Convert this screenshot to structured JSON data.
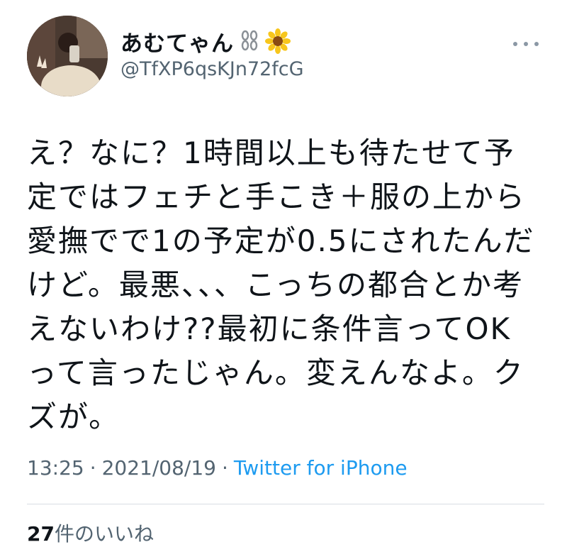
{
  "user": {
    "display_name": "あむてゃん",
    "name_icons": [
      "chain-icon",
      "sunflower-icon"
    ],
    "handle": "@TfXP6qsKJn72fcG"
  },
  "tweet": {
    "text": "え？なに？1時間以上も待たせて予\n定ではフェチと手こき＋服の上から\n愛撫でで1の予定が0.5にされたんだ\nけど。最悪、、、こっちの都合とか考\nえないわけ??最初に条件言ってOK\nって言ったじゃん。変えんなよ。ク\nズが。"
  },
  "meta": {
    "time": "13:25",
    "separator": "·",
    "date": "2021/08/19",
    "source": "Twitter for iPhone"
  },
  "likes": {
    "count": "27",
    "label": "件のいいね"
  },
  "colors": {
    "text_primary": "#0f1419",
    "text_secondary": "#536471",
    "link": "#1d9bf0",
    "divider": "#d8dee3"
  }
}
